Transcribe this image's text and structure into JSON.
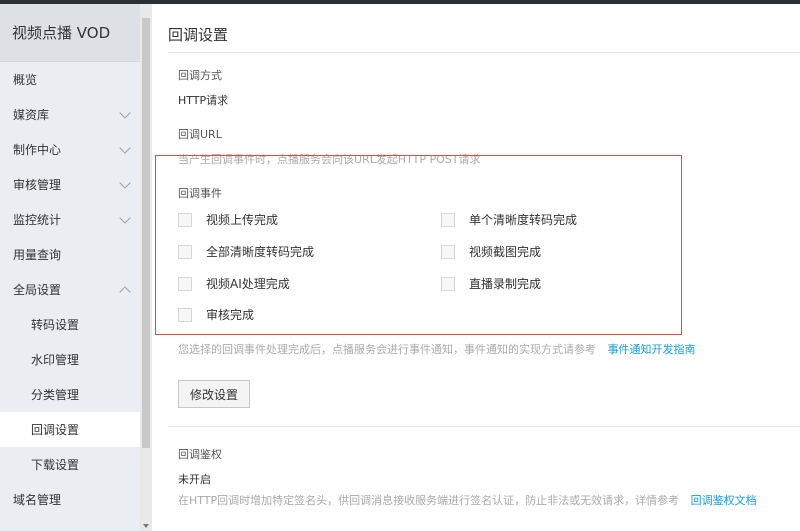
{
  "sidebar": {
    "brand": "视频点播 VOD",
    "items": [
      {
        "label": "概览"
      },
      {
        "label": "媒资库"
      },
      {
        "label": "制作中心"
      },
      {
        "label": "审核管理"
      },
      {
        "label": "监控统计"
      },
      {
        "label": "用量查询"
      },
      {
        "label": "全局设置"
      },
      {
        "label": "转码设置"
      },
      {
        "label": "水印管理"
      },
      {
        "label": "分类管理"
      },
      {
        "label": "回调设置"
      },
      {
        "label": "下载设置"
      },
      {
        "label": "域名管理"
      }
    ]
  },
  "main": {
    "title": "回调设置",
    "method_label": "回调方式",
    "method_value": "HTTP请求",
    "url_label": "回调URL",
    "url_help": "当产生回调事件时，点播服务会向该URL发起HTTP POST请求",
    "events_label": "回调事件",
    "events": [
      {
        "label": "视频上传完成",
        "checked": false
      },
      {
        "label": "单个清晰度转码完成",
        "checked": false
      },
      {
        "label": "全部清晰度转码完成",
        "checked": false
      },
      {
        "label": "视频截图完成",
        "checked": false
      },
      {
        "label": "视频AI处理完成",
        "checked": false
      },
      {
        "label": "直播录制完成",
        "checked": false
      },
      {
        "label": "审核完成",
        "checked": false
      }
    ],
    "events_help": "您选择的回调事件处理完成后，点播服务会进行事件通知，事件通知的实现方式请参考",
    "events_help_link": "事件通知开发指南",
    "modify_button": "修改设置",
    "auth_label": "回调鉴权",
    "auth_value": "未开启",
    "auth_help": "在HTTP回调时增加特定签名头，供回调消息接收服务端进行签名认证，防止非法或无效请求，详情参考",
    "auth_help_link": "回调鉴权文档"
  }
}
